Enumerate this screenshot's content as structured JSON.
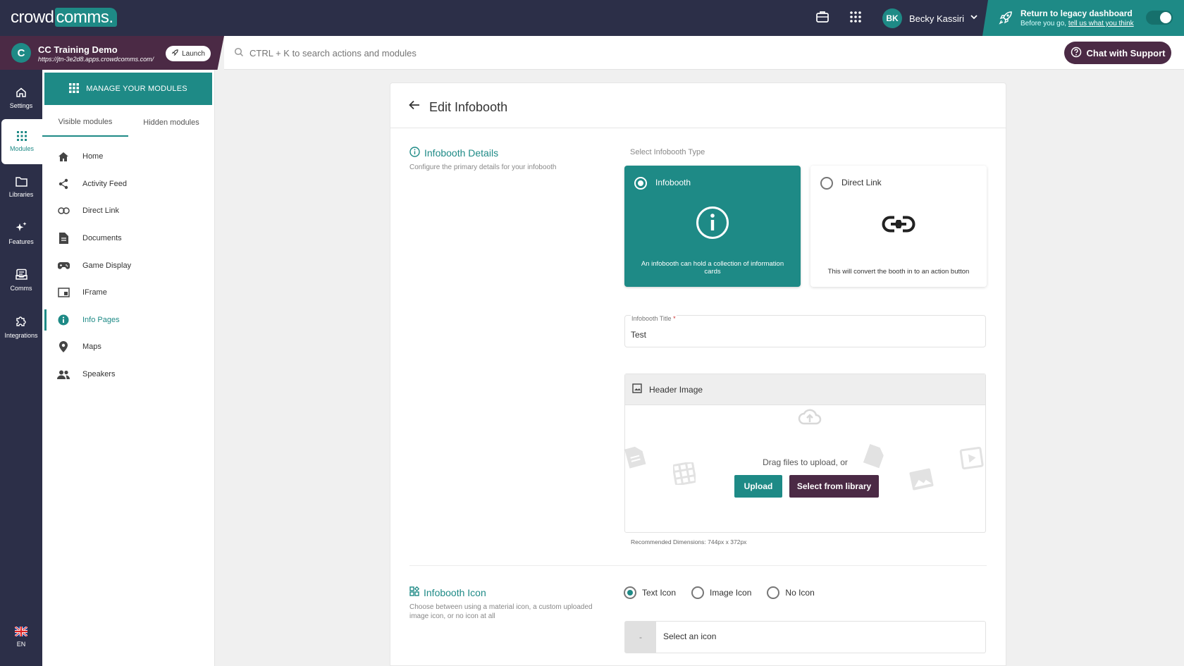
{
  "topbar": {
    "logo_text": "crowd",
    "logo_accent": "comms.",
    "user_initials": "BK",
    "user_name": "Becky Kassiri",
    "legacy_title": "Return to legacy dashboard",
    "legacy_sub": "Before you go,",
    "legacy_link": "tell us what you think"
  },
  "event": {
    "name": "CC Training Demo",
    "url": "https://jtn-3e2d8.apps.crowdcomms.com/",
    "launch_label": "Launch"
  },
  "search": {
    "placeholder": "CTRL + K to search actions and modules"
  },
  "support": {
    "label": "Chat with Support"
  },
  "rail": {
    "items": [
      {
        "label": "Settings",
        "icon": "home-icon"
      },
      {
        "label": "Modules",
        "icon": "grid-icon"
      },
      {
        "label": "Libraries",
        "icon": "folder-icon"
      },
      {
        "label": "Features",
        "icon": "sparkle-icon"
      },
      {
        "label": "Comms",
        "icon": "inbox-icon"
      },
      {
        "label": "Integrations",
        "icon": "puzzle-icon"
      }
    ],
    "language": "EN"
  },
  "modules": {
    "manage_label": "MANAGE YOUR MODULES",
    "tabs": [
      {
        "label": "Visible modules"
      },
      {
        "label": "Hidden modules"
      }
    ],
    "items": [
      {
        "label": "Home",
        "icon": "home-icon"
      },
      {
        "label": "Activity Feed",
        "icon": "share-icon"
      },
      {
        "label": "Direct Link",
        "icon": "link-icon"
      },
      {
        "label": "Documents",
        "icon": "document-icon"
      },
      {
        "label": "Game Display",
        "icon": "gamepad-icon"
      },
      {
        "label": "IFrame",
        "icon": "iframe-icon"
      },
      {
        "label": "Info Pages",
        "icon": "info-icon"
      },
      {
        "label": "Maps",
        "icon": "map-pin-icon"
      },
      {
        "label": "Speakers",
        "icon": "people-icon"
      }
    ]
  },
  "editor": {
    "title": "Edit Infobooth",
    "details": {
      "title": "Infobooth Details",
      "desc": "Configure the primary details for your infobooth"
    },
    "type_label": "Select Infobooth Type",
    "types": [
      {
        "name": "Infobooth",
        "desc": "An infobooth can hold a collection of information cards"
      },
      {
        "name": "Direct Link",
        "desc": "This will convert the booth in to an action button"
      }
    ],
    "title_field": {
      "label": "Infobooth Title",
      "required_mark": "*",
      "value": "Test"
    },
    "header_image": {
      "title": "Header Image",
      "drag_text": "Drag files to upload, or",
      "upload_label": "Upload",
      "library_label": "Select from library",
      "recommended": "Recommended Dimensions: 744px x 372px"
    },
    "icon_section": {
      "title": "Infobooth Icon",
      "desc": "Choose between using a material icon, a custom uploaded image icon, or no icon at all",
      "options": [
        {
          "label": "Text Icon"
        },
        {
          "label": "Image Icon"
        },
        {
          "label": "No Icon"
        }
      ],
      "select_prefix": "-",
      "select_placeholder": "Select an icon"
    }
  },
  "colors": {
    "teal": "#1e8a86",
    "navy": "#2c2f48",
    "plum": "#4b2a45"
  }
}
